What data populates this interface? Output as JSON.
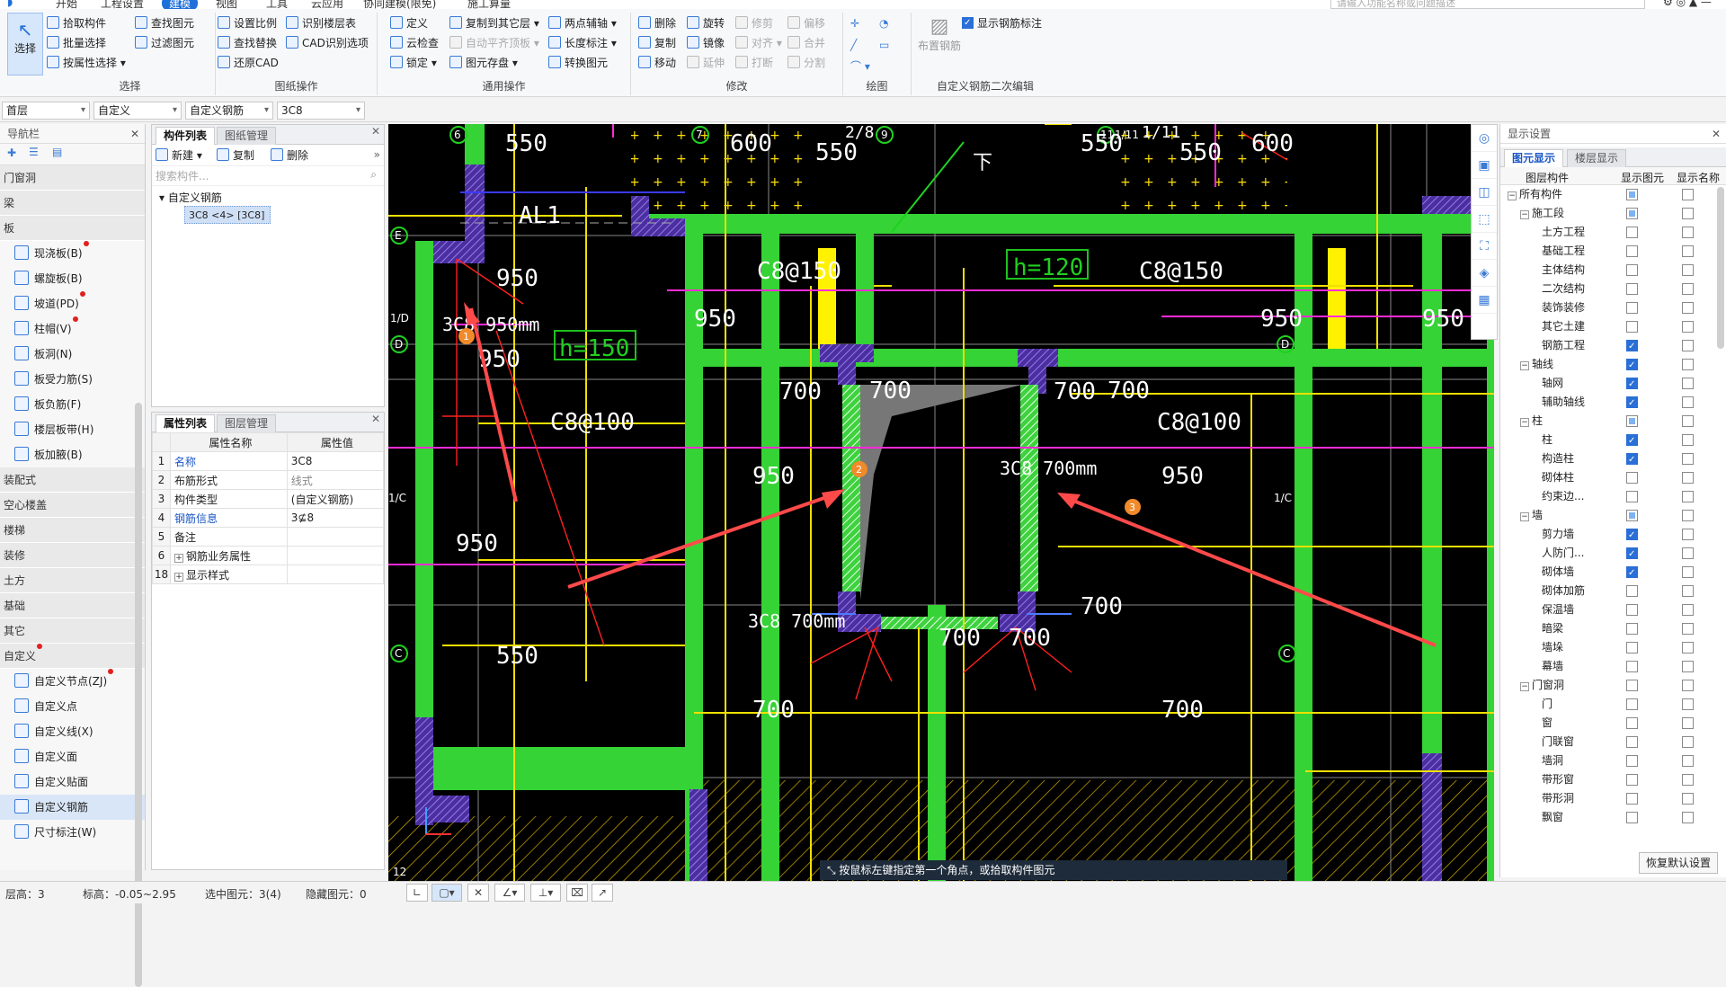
{
  "menu": {
    "items": [
      "开始",
      "工程设置",
      "建模",
      "视图",
      "工具",
      "云应用",
      "协同建模(限免)",
      "施工算量"
    ],
    "active": 2
  },
  "search": {
    "placeholder": "请输入功能名称或问题描述"
  },
  "ribbon": {
    "select_label": "选择",
    "groups": [
      {
        "title": "选择",
        "items": [
          "拾取构件",
          "批量选择",
          "按属性选择",
          "查找图元",
          "过滤图元"
        ]
      },
      {
        "title": "图纸操作",
        "items": [
          "设置比例",
          "查找替换",
          "还原CAD",
          "识别楼层表",
          "CAD识别选项"
        ]
      },
      {
        "title": "通用操作",
        "items": [
          "定义",
          "云检查",
          "锁定",
          "复制到其它层",
          "自动平齐顶板",
          "图元存盘",
          "两点辅轴",
          "长度标注",
          "转换图元"
        ]
      },
      {
        "title": "修改",
        "items": [
          "删除",
          "复制",
          "移动",
          "旋转",
          "镜像",
          "延伸",
          "修剪",
          "对齐",
          "打断",
          "偏移",
          "合并",
          "分割"
        ]
      },
      {
        "title": "绘图",
        "items": []
      },
      {
        "title": "自定义钢筋二次编辑",
        "items": [
          "布置钢筋",
          "显示钢筋标注"
        ]
      }
    ]
  },
  "combos": [
    "首层",
    "自定义",
    "自定义钢筋",
    "3C8"
  ],
  "nav": {
    "title": "导航栏",
    "cats": [
      {
        "label": "门窗洞"
      },
      {
        "label": "梁"
      },
      {
        "label": "板"
      }
    ],
    "board_items": [
      {
        "label": "现浇板(B)",
        "dot": true
      },
      {
        "label": "螺旋板(B)",
        "dot": false
      },
      {
        "label": "坡道(PD)",
        "dot": true
      },
      {
        "label": "柱帽(V)",
        "dot": true
      },
      {
        "label": "板洞(N)",
        "dot": false
      },
      {
        "label": "板受力筋(S)",
        "dot": false
      },
      {
        "label": "板负筋(F)",
        "dot": false
      },
      {
        "label": "楼层板带(H)",
        "dot": false
      },
      {
        "label": "板加腋(B)",
        "dot": false
      }
    ],
    "cats2": [
      "装配式",
      "空心楼盖",
      "楼梯",
      "装修",
      "土方",
      "基础",
      "其它",
      "自定义"
    ],
    "custom_items": [
      {
        "label": "自定义节点(ZJ)",
        "dot": true
      },
      {
        "label": "自定义点",
        "dot": false
      },
      {
        "label": "自定义线(X)",
        "dot": false
      },
      {
        "label": "自定义面",
        "dot": false
      },
      {
        "label": "自定义贴面",
        "dot": false
      },
      {
        "label": "自定义钢筋",
        "dot": false
      },
      {
        "label": "尺寸标注(W)",
        "dot": false
      }
    ]
  },
  "complist": {
    "tabs": [
      "构件列表",
      "图纸管理"
    ],
    "actions": [
      "新建",
      "复制",
      "删除"
    ],
    "search_placeholder": "搜索构件...",
    "tree_root": "自定义钢筋",
    "tree_item": "3C8 <4> [3C8]"
  },
  "proplist": {
    "tabs": [
      "属性列表",
      "图层管理"
    ],
    "headers": [
      "属性名称",
      "属性值"
    ],
    "rows": [
      {
        "n": "1",
        "name": "名称",
        "value": "3C8",
        "blue": true
      },
      {
        "n": "2",
        "name": "布筋形式",
        "value": "线式",
        "blue": false,
        "gray": true
      },
      {
        "n": "3",
        "name": "构件类型",
        "value": "(自定义钢筋)",
        "blue": false
      },
      {
        "n": "4",
        "name": "钢筋信息",
        "value": "3⊈8",
        "blue": true
      },
      {
        "n": "5",
        "name": "备注",
        "value": "",
        "blue": false
      },
      {
        "n": "6",
        "name": "钢筋业务属性",
        "value": "",
        "blue": false,
        "plus": true
      },
      {
        "n": "18",
        "name": "显示样式",
        "value": "",
        "blue": false,
        "plus": true
      }
    ]
  },
  "display": {
    "title": "显示设置",
    "tabs": [
      "图元显示",
      "楼层显示"
    ],
    "headers": [
      "图层构件",
      "显示图元",
      "显示名称"
    ],
    "rows": [
      {
        "label": "所有构件",
        "lvl": 0,
        "tog": "−",
        "a": "part",
        "b": "off"
      },
      {
        "label": "施工段",
        "lvl": 1,
        "tog": "−",
        "a": "part",
        "b": "off"
      },
      {
        "label": "土方工程",
        "lvl": 2,
        "a": "off",
        "b": "off"
      },
      {
        "label": "基础工程",
        "lvl": 2,
        "a": "off",
        "b": "off"
      },
      {
        "label": "主体结构",
        "lvl": 2,
        "a": "off",
        "b": "off"
      },
      {
        "label": "二次结构",
        "lvl": 2,
        "a": "off",
        "b": "off"
      },
      {
        "label": "装饰装修",
        "lvl": 2,
        "a": "off",
        "b": "off"
      },
      {
        "label": "其它土建",
        "lvl": 2,
        "a": "off",
        "b": "off"
      },
      {
        "label": "钢筋工程",
        "lvl": 2,
        "a": "on",
        "b": "off"
      },
      {
        "label": "轴线",
        "lvl": 1,
        "tog": "−",
        "a": "on",
        "b": "off"
      },
      {
        "label": "轴网",
        "lvl": 2,
        "a": "on",
        "b": "off"
      },
      {
        "label": "辅助轴线",
        "lvl": 2,
        "a": "on",
        "b": "off"
      },
      {
        "label": "柱",
        "lvl": 1,
        "tog": "−",
        "a": "part",
        "b": "off"
      },
      {
        "label": "柱",
        "lvl": 2,
        "a": "on",
        "b": "off"
      },
      {
        "label": "构造柱",
        "lvl": 2,
        "a": "on",
        "b": "off"
      },
      {
        "label": "砌体柱",
        "lvl": 2,
        "a": "off",
        "b": "off"
      },
      {
        "label": "约束边...",
        "lvl": 2,
        "a": "off",
        "b": "off"
      },
      {
        "label": "墙",
        "lvl": 1,
        "tog": "−",
        "a": "part",
        "b": "off"
      },
      {
        "label": "剪力墙",
        "lvl": 2,
        "a": "on",
        "b": "off"
      },
      {
        "label": "人防门...",
        "lvl": 2,
        "a": "on",
        "b": "off"
      },
      {
        "label": "砌体墙",
        "lvl": 2,
        "a": "on",
        "b": "off"
      },
      {
        "label": "砌体加筋",
        "lvl": 2,
        "a": "off",
        "b": "off"
      },
      {
        "label": "保温墙",
        "lvl": 2,
        "a": "off",
        "b": "off"
      },
      {
        "label": "暗梁",
        "lvl": 2,
        "a": "off",
        "b": "off"
      },
      {
        "label": "墙垛",
        "lvl": 2,
        "a": "off",
        "b": "off"
      },
      {
        "label": "幕墙",
        "lvl": 2,
        "a": "off",
        "b": "off"
      },
      {
        "label": "门窗洞",
        "lvl": 1,
        "tog": "−",
        "a": "off",
        "b": "off"
      },
      {
        "label": "门",
        "lvl": 2,
        "a": "off",
        "b": "off"
      },
      {
        "label": "窗",
        "lvl": 2,
        "a": "off",
        "b": "off"
      },
      {
        "label": "门联窗",
        "lvl": 2,
        "a": "off",
        "b": "off"
      },
      {
        "label": "墙洞",
        "lvl": 2,
        "a": "off",
        "b": "off"
      },
      {
        "label": "带形窗",
        "lvl": 2,
        "a": "off",
        "b": "off"
      },
      {
        "label": "带形洞",
        "lvl": 2,
        "a": "off",
        "b": "off"
      },
      {
        "label": "飘窗",
        "lvl": 2,
        "a": "off",
        "b": "off"
      }
    ],
    "restore": "恢复默认设置"
  },
  "status": {
    "floor": "层高：3",
    "elev": "标高：-0.05~2.95",
    "selected": "选中图元：3(4)",
    "hidden": "隐藏图元：0"
  },
  "tip": "按鼠标左键指定第一个角点，或拾取构件图元",
  "cad": {
    "axes_top": [
      "6",
      "7",
      "8",
      "9",
      "11",
      "1/11",
      "12"
    ],
    "axes_left": [
      "E",
      "1/D",
      "D",
      "1/C",
      "C"
    ],
    "labels": [
      "550",
      "550",
      "550",
      "550",
      "550",
      "600",
      "600",
      "2/8",
      "1/11",
      "AL1",
      "950",
      "950",
      "950",
      "950",
      "950",
      "950",
      "950",
      "950",
      "C8@150",
      "C8@150",
      "C8@100",
      "C8@100",
      "h=120",
      "h=150",
      "700",
      "700",
      "700",
      "700",
      "700",
      "700",
      "700",
      "700",
      "700",
      "3C8 950mm",
      "3C8 700mm",
      "3C8 700mm",
      "下"
    ],
    "markers": [
      "1",
      "2",
      "3"
    ]
  }
}
